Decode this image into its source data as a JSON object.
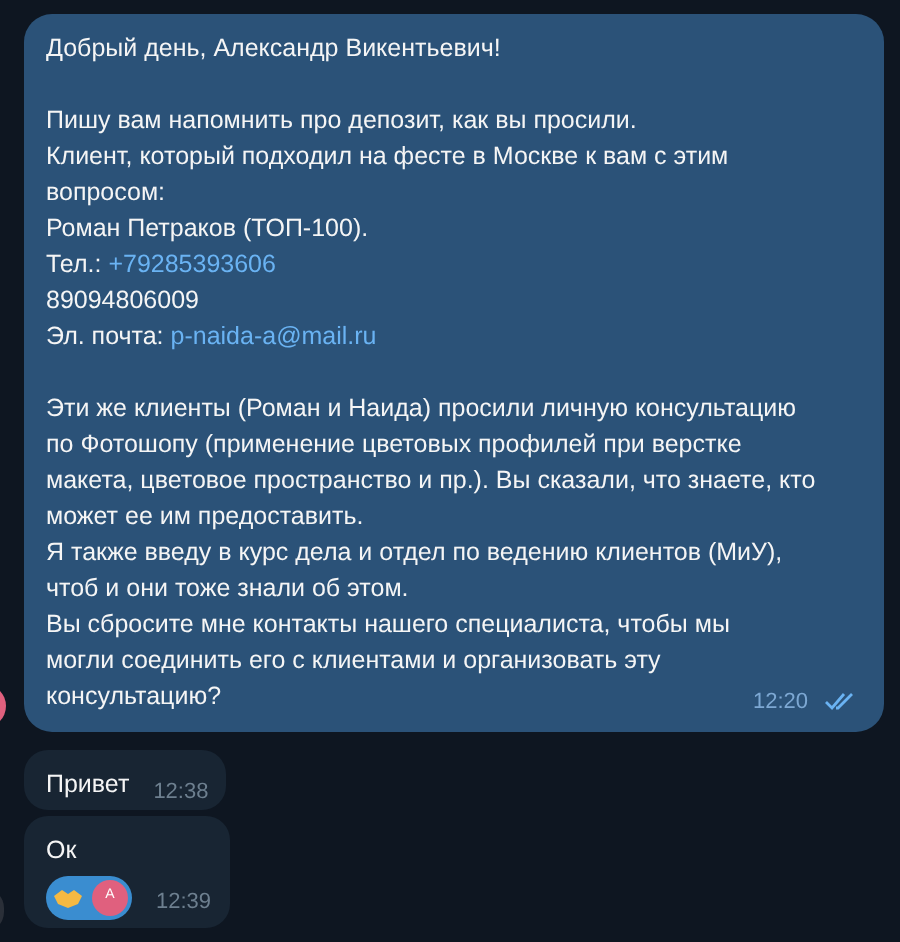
{
  "messages": [
    {
      "kind": "outgoing",
      "paragraphs": [
        [
          {
            "text": "Добрый день, Александр Викентьевич!"
          }
        ],
        [
          {
            "text": "Пишу вам напомнить про депозит, как вы просили."
          },
          {
            "text": "Клиент, который подходил на фесте в Москве к вам с этим"
          },
          {
            "text": "вопросом:"
          },
          {
            "text": "Роман Петраков (ТОП-100)."
          },
          {
            "text": "Тел.: ",
            "link": "+79285393606"
          },
          {
            "text": "89094806009"
          },
          {
            "text": "Эл. почта: ",
            "link": "p-naida-a@mail.ru"
          }
        ],
        [
          {
            "text": "Эти же клиенты (Роман и Наида) просили личную консультацию"
          },
          {
            "text": "по Фотошопу (применение цветовых профилей при верстке"
          },
          {
            "text": "макета, цветовое пространство и пр.). Вы сказали, что знаете, кто"
          },
          {
            "text": "может ее им предоставить."
          },
          {
            "text": "Я также введу в курс дела и отдел по ведению клиентов (МиУ),"
          },
          {
            "text": "чтоб и они тоже знали об этом."
          },
          {
            "text": "Вы сбросите мне контакты нашего специалиста, чтобы мы"
          },
          {
            "text": "могли соединить его с клиентами и организовать эту"
          },
          {
            "text": "консультацию?"
          }
        ]
      ],
      "time": "12:20",
      "read": true
    },
    {
      "kind": "incoming",
      "paragraphs": [
        [
          {
            "text": "Привет"
          }
        ]
      ],
      "time": "12:38"
    },
    {
      "kind": "incoming",
      "paragraphs": [
        [
          {
            "text": "Ок"
          }
        ]
      ],
      "time": "12:39",
      "reaction": {
        "avatar_letter": "A"
      }
    }
  ]
}
